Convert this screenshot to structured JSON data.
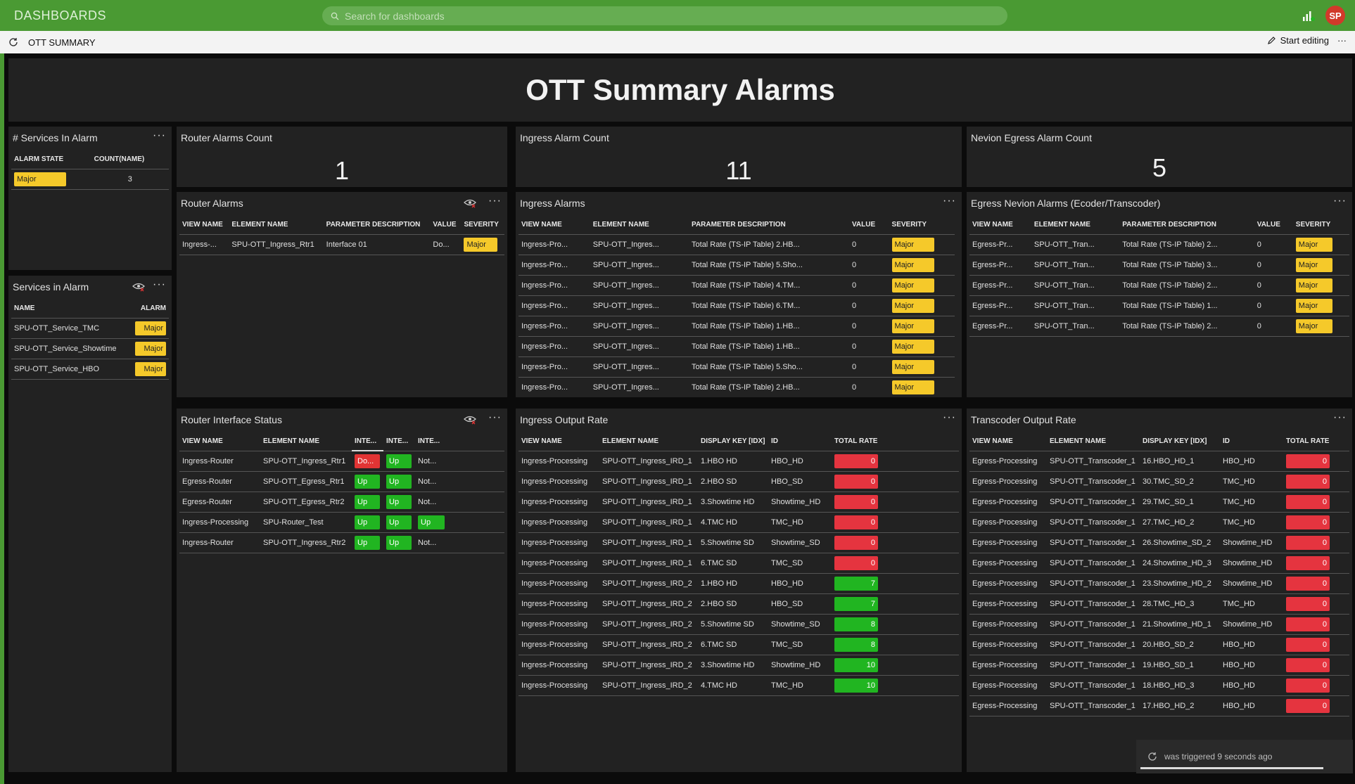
{
  "header": {
    "brand": "DASHBOARDS",
    "search_placeholder": "Search for dashboards",
    "avatar_initials": "SP",
    "accent_color": "#4a9a33"
  },
  "subbar": {
    "title": "OTT SUMMARY",
    "start_editing": "Start editing",
    "more": "···"
  },
  "banner": {
    "title": "OTT Summary Alarms"
  },
  "services_count": {
    "title": "# Services In Alarm",
    "headers": [
      "ALARM STATE",
      "COUNT(NAME)"
    ],
    "rows": [
      {
        "state": "Major",
        "count": "3"
      }
    ]
  },
  "services_in_alarm": {
    "title": "Services in Alarm",
    "headers": [
      "NAME",
      "ALARM"
    ],
    "rows": [
      {
        "name": "SPU-OTT_Service_TMC",
        "alarm": "Major"
      },
      {
        "name": "SPU-OTT_Service_Showtime",
        "alarm": "Major"
      },
      {
        "name": "SPU-OTT_Service_HBO",
        "alarm": "Major"
      }
    ]
  },
  "router_alarms_count": {
    "title": "Router Alarms Count",
    "value": "1"
  },
  "ingress_alarm_count": {
    "title": "Ingress Alarm Count",
    "value": "11"
  },
  "egress_alarm_count": {
    "title": "Nevion Egress Alarm Count",
    "value": "5"
  },
  "router_alarms": {
    "title": "Router Alarms",
    "headers": [
      "VIEW NAME",
      "ELEMENT NAME",
      "PARAMETER DESCRIPTION",
      "VALUE",
      "SEVERITY"
    ],
    "rows": [
      {
        "view": "Ingress-...",
        "element": "SPU-OTT_Ingress_Rtr1",
        "param": "Interface 01",
        "value": "Do...",
        "severity": "Major"
      }
    ]
  },
  "ingress_alarms": {
    "title": "Ingress Alarms",
    "headers": [
      "VIEW NAME",
      "ELEMENT NAME",
      "PARAMETER DESCRIPTION",
      "VALUE",
      "SEVERITY"
    ],
    "rows": [
      {
        "view": "Ingress-Pro...",
        "element": "SPU-OTT_Ingres...",
        "param": "Total Rate (TS-IP Table) 2.HB...",
        "value": "0",
        "severity": "Major"
      },
      {
        "view": "Ingress-Pro...",
        "element": "SPU-OTT_Ingres...",
        "param": "Total Rate (TS-IP Table) 5.Sho...",
        "value": "0",
        "severity": "Major"
      },
      {
        "view": "Ingress-Pro...",
        "element": "SPU-OTT_Ingres...",
        "param": "Total Rate (TS-IP Table) 4.TM...",
        "value": "0",
        "severity": "Major"
      },
      {
        "view": "Ingress-Pro...",
        "element": "SPU-OTT_Ingres...",
        "param": "Total Rate (TS-IP Table) 6.TM...",
        "value": "0",
        "severity": "Major"
      },
      {
        "view": "Ingress-Pro...",
        "element": "SPU-OTT_Ingres...",
        "param": "Total Rate (TS-IP Table) 1.HB...",
        "value": "0",
        "severity": "Major"
      },
      {
        "view": "Ingress-Pro...",
        "element": "SPU-OTT_Ingres...",
        "param": "Total Rate (TS-IP Table) 1.HB...",
        "value": "0",
        "severity": "Major"
      },
      {
        "view": "Ingress-Pro...",
        "element": "SPU-OTT_Ingres...",
        "param": "Total Rate (TS-IP Table) 5.Sho...",
        "value": "0",
        "severity": "Major"
      },
      {
        "view": "Ingress-Pro...",
        "element": "SPU-OTT_Ingres...",
        "param": "Total Rate (TS-IP Table) 2.HB...",
        "value": "0",
        "severity": "Major"
      }
    ]
  },
  "egress_alarms": {
    "title": "Egress Nevion Alarms (Ecoder/Transcoder)",
    "headers": [
      "VIEW NAME",
      "ELEMENT NAME",
      "PARAMETER DESCRIPTION",
      "VALUE",
      "SEVERITY"
    ],
    "rows": [
      {
        "view": "Egress-Pr...",
        "element": "SPU-OTT_Tran...",
        "param": "Total Rate (TS-IP Table) 2...",
        "value": "0",
        "severity": "Major"
      },
      {
        "view": "Egress-Pr...",
        "element": "SPU-OTT_Tran...",
        "param": "Total Rate (TS-IP Table) 3...",
        "value": "0",
        "severity": "Major"
      },
      {
        "view": "Egress-Pr...",
        "element": "SPU-OTT_Tran...",
        "param": "Total Rate (TS-IP Table) 2...",
        "value": "0",
        "severity": "Major"
      },
      {
        "view": "Egress-Pr...",
        "element": "SPU-OTT_Tran...",
        "param": "Total Rate (TS-IP Table) 1...",
        "value": "0",
        "severity": "Major"
      },
      {
        "view": "Egress-Pr...",
        "element": "SPU-OTT_Tran...",
        "param": "Total Rate (TS-IP Table) 2...",
        "value": "0",
        "severity": "Major"
      }
    ]
  },
  "router_interface": {
    "title": "Router Interface Status",
    "headers": [
      "VIEW NAME",
      "ELEMENT NAME",
      "INTE...",
      "INTE...",
      "INTE..."
    ],
    "rows": [
      {
        "view": "Ingress-Router",
        "element": "SPU-OTT_Ingress_Rtr1",
        "i1": "Do...",
        "i1s": "down",
        "i2": "Up",
        "i2s": "up",
        "i3": "Not...",
        "i3s": "none"
      },
      {
        "view": "Egress-Router",
        "element": "SPU-OTT_Egress_Rtr1",
        "i1": "Up",
        "i1s": "up",
        "i2": "Up",
        "i2s": "up",
        "i3": "Not...",
        "i3s": "none"
      },
      {
        "view": "Egress-Router",
        "element": "SPU-OTT_Egress_Rtr2",
        "i1": "Up",
        "i1s": "up",
        "i2": "Up",
        "i2s": "up",
        "i3": "Not...",
        "i3s": "none"
      },
      {
        "view": "Ingress-Processing",
        "element": "SPU-Router_Test",
        "i1": "Up",
        "i1s": "up",
        "i2": "Up",
        "i2s": "up",
        "i3": "Up",
        "i3s": "up"
      },
      {
        "view": "Ingress-Router",
        "element": "SPU-OTT_Ingress_Rtr2",
        "i1": "Up",
        "i1s": "up",
        "i2": "Up",
        "i2s": "up",
        "i3": "Not...",
        "i3s": "none"
      }
    ]
  },
  "ingress_output": {
    "title": "Ingress Output Rate",
    "headers": [
      "VIEW NAME",
      "ELEMENT NAME",
      "DISPLAY KEY [IDX]",
      "ID",
      "TOTAL RATE"
    ],
    "rows": [
      {
        "view": "Ingress-Processing",
        "element": "SPU-OTT_Ingress_IRD_1",
        "key": "1.HBO HD",
        "id": "HBO_HD",
        "rate": "0",
        "status": "red"
      },
      {
        "view": "Ingress-Processing",
        "element": "SPU-OTT_Ingress_IRD_1",
        "key": "2.HBO SD",
        "id": "HBO_SD",
        "rate": "0",
        "status": "red"
      },
      {
        "view": "Ingress-Processing",
        "element": "SPU-OTT_Ingress_IRD_1",
        "key": "3.Showtime HD",
        "id": "Showtime_HD",
        "rate": "0",
        "status": "red"
      },
      {
        "view": "Ingress-Processing",
        "element": "SPU-OTT_Ingress_IRD_1",
        "key": "4.TMC HD",
        "id": "TMC_HD",
        "rate": "0",
        "status": "red"
      },
      {
        "view": "Ingress-Processing",
        "element": "SPU-OTT_Ingress_IRD_1",
        "key": "5.Showtime SD",
        "id": "Showtime_SD",
        "rate": "0",
        "status": "red"
      },
      {
        "view": "Ingress-Processing",
        "element": "SPU-OTT_Ingress_IRD_1",
        "key": "6.TMC SD",
        "id": "TMC_SD",
        "rate": "0",
        "status": "red"
      },
      {
        "view": "Ingress-Processing",
        "element": "SPU-OTT_Ingress_IRD_2",
        "key": "1.HBO HD",
        "id": "HBO_HD",
        "rate": "7",
        "status": "green"
      },
      {
        "view": "Ingress-Processing",
        "element": "SPU-OTT_Ingress_IRD_2",
        "key": "2.HBO SD",
        "id": "HBO_SD",
        "rate": "7",
        "status": "green"
      },
      {
        "view": "Ingress-Processing",
        "element": "SPU-OTT_Ingress_IRD_2",
        "key": "5.Showtime SD",
        "id": "Showtime_SD",
        "rate": "8",
        "status": "green"
      },
      {
        "view": "Ingress-Processing",
        "element": "SPU-OTT_Ingress_IRD_2",
        "key": "6.TMC SD",
        "id": "TMC_SD",
        "rate": "8",
        "status": "green"
      },
      {
        "view": "Ingress-Processing",
        "element": "SPU-OTT_Ingress_IRD_2",
        "key": "3.Showtime HD",
        "id": "Showtime_HD",
        "rate": "10",
        "status": "green"
      },
      {
        "view": "Ingress-Processing",
        "element": "SPU-OTT_Ingress_IRD_2",
        "key": "4.TMC HD",
        "id": "TMC_HD",
        "rate": "10",
        "status": "green"
      }
    ]
  },
  "transcoder_output": {
    "title": "Transcoder Output Rate",
    "headers": [
      "VIEW NAME",
      "ELEMENT NAME",
      "DISPLAY KEY [IDX]",
      "ID",
      "TOTAL RATE"
    ],
    "rows": [
      {
        "view": "Egress-Processing",
        "element": "SPU-OTT_Transcoder_1",
        "key": "16.HBO_HD_1",
        "id": "HBO_HD",
        "rate": "0",
        "status": "red"
      },
      {
        "view": "Egress-Processing",
        "element": "SPU-OTT_Transcoder_1",
        "key": "30.TMC_SD_2",
        "id": "TMC_HD",
        "rate": "0",
        "status": "red"
      },
      {
        "view": "Egress-Processing",
        "element": "SPU-OTT_Transcoder_1",
        "key": "29.TMC_SD_1",
        "id": "TMC_HD",
        "rate": "0",
        "status": "red"
      },
      {
        "view": "Egress-Processing",
        "element": "SPU-OTT_Transcoder_1",
        "key": "27.TMC_HD_2",
        "id": "TMC_HD",
        "rate": "0",
        "status": "red"
      },
      {
        "view": "Egress-Processing",
        "element": "SPU-OTT_Transcoder_1",
        "key": "26.Showtime_SD_2",
        "id": "Showtime_HD",
        "rate": "0",
        "status": "red"
      },
      {
        "view": "Egress-Processing",
        "element": "SPU-OTT_Transcoder_1",
        "key": "24.Showtime_HD_3",
        "id": "Showtime_HD",
        "rate": "0",
        "status": "red"
      },
      {
        "view": "Egress-Processing",
        "element": "SPU-OTT_Transcoder_1",
        "key": "23.Showtime_HD_2",
        "id": "Showtime_HD",
        "rate": "0",
        "status": "red"
      },
      {
        "view": "Egress-Processing",
        "element": "SPU-OTT_Transcoder_1",
        "key": "28.TMC_HD_3",
        "id": "TMC_HD",
        "rate": "0",
        "status": "red"
      },
      {
        "view": "Egress-Processing",
        "element": "SPU-OTT_Transcoder_1",
        "key": "21.Showtime_HD_1",
        "id": "Showtime_HD",
        "rate": "0",
        "status": "red"
      },
      {
        "view": "Egress-Processing",
        "element": "SPU-OTT_Transcoder_1",
        "key": "20.HBO_SD_2",
        "id": "HBO_HD",
        "rate": "0",
        "status": "red"
      },
      {
        "view": "Egress-Processing",
        "element": "SPU-OTT_Transcoder_1",
        "key": "19.HBO_SD_1",
        "id": "HBO_HD",
        "rate": "0",
        "status": "red"
      },
      {
        "view": "Egress-Processing",
        "element": "SPU-OTT_Transcoder_1",
        "key": "18.HBO_HD_3",
        "id": "HBO_HD",
        "rate": "0",
        "status": "red"
      },
      {
        "view": "Egress-Processing",
        "element": "SPU-OTT_Transcoder_1",
        "key": "17.HBO_HD_2",
        "id": "HBO_HD",
        "rate": "0",
        "status": "red"
      }
    ]
  },
  "toast": {
    "text": "was triggered 9 seconds ago"
  },
  "panel_menu": "···"
}
